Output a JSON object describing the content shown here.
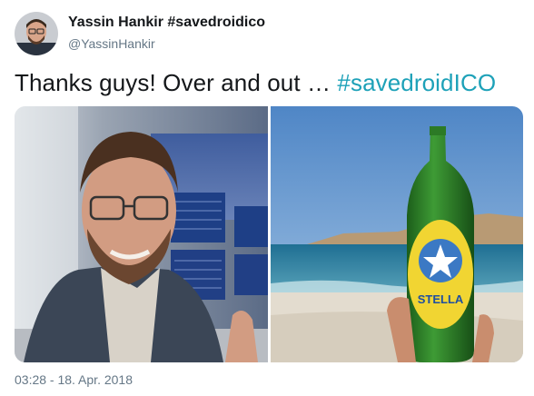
{
  "author": {
    "name": "Yassin Hankir #savedroidico",
    "handle": "@YassinHankir"
  },
  "tweet": {
    "text": "Thanks guys! Over and out … ",
    "hashtag": "#savedroidICO",
    "timestamp": "03:28 - 18. Apr. 2018"
  },
  "media": {
    "left_photo": "selfie-airport",
    "right_photo": "beer-bottle-beach",
    "bottle_label": "STELLA"
  },
  "colors": {
    "hashtag": "#1da1b8",
    "secondary_text": "#657786"
  }
}
